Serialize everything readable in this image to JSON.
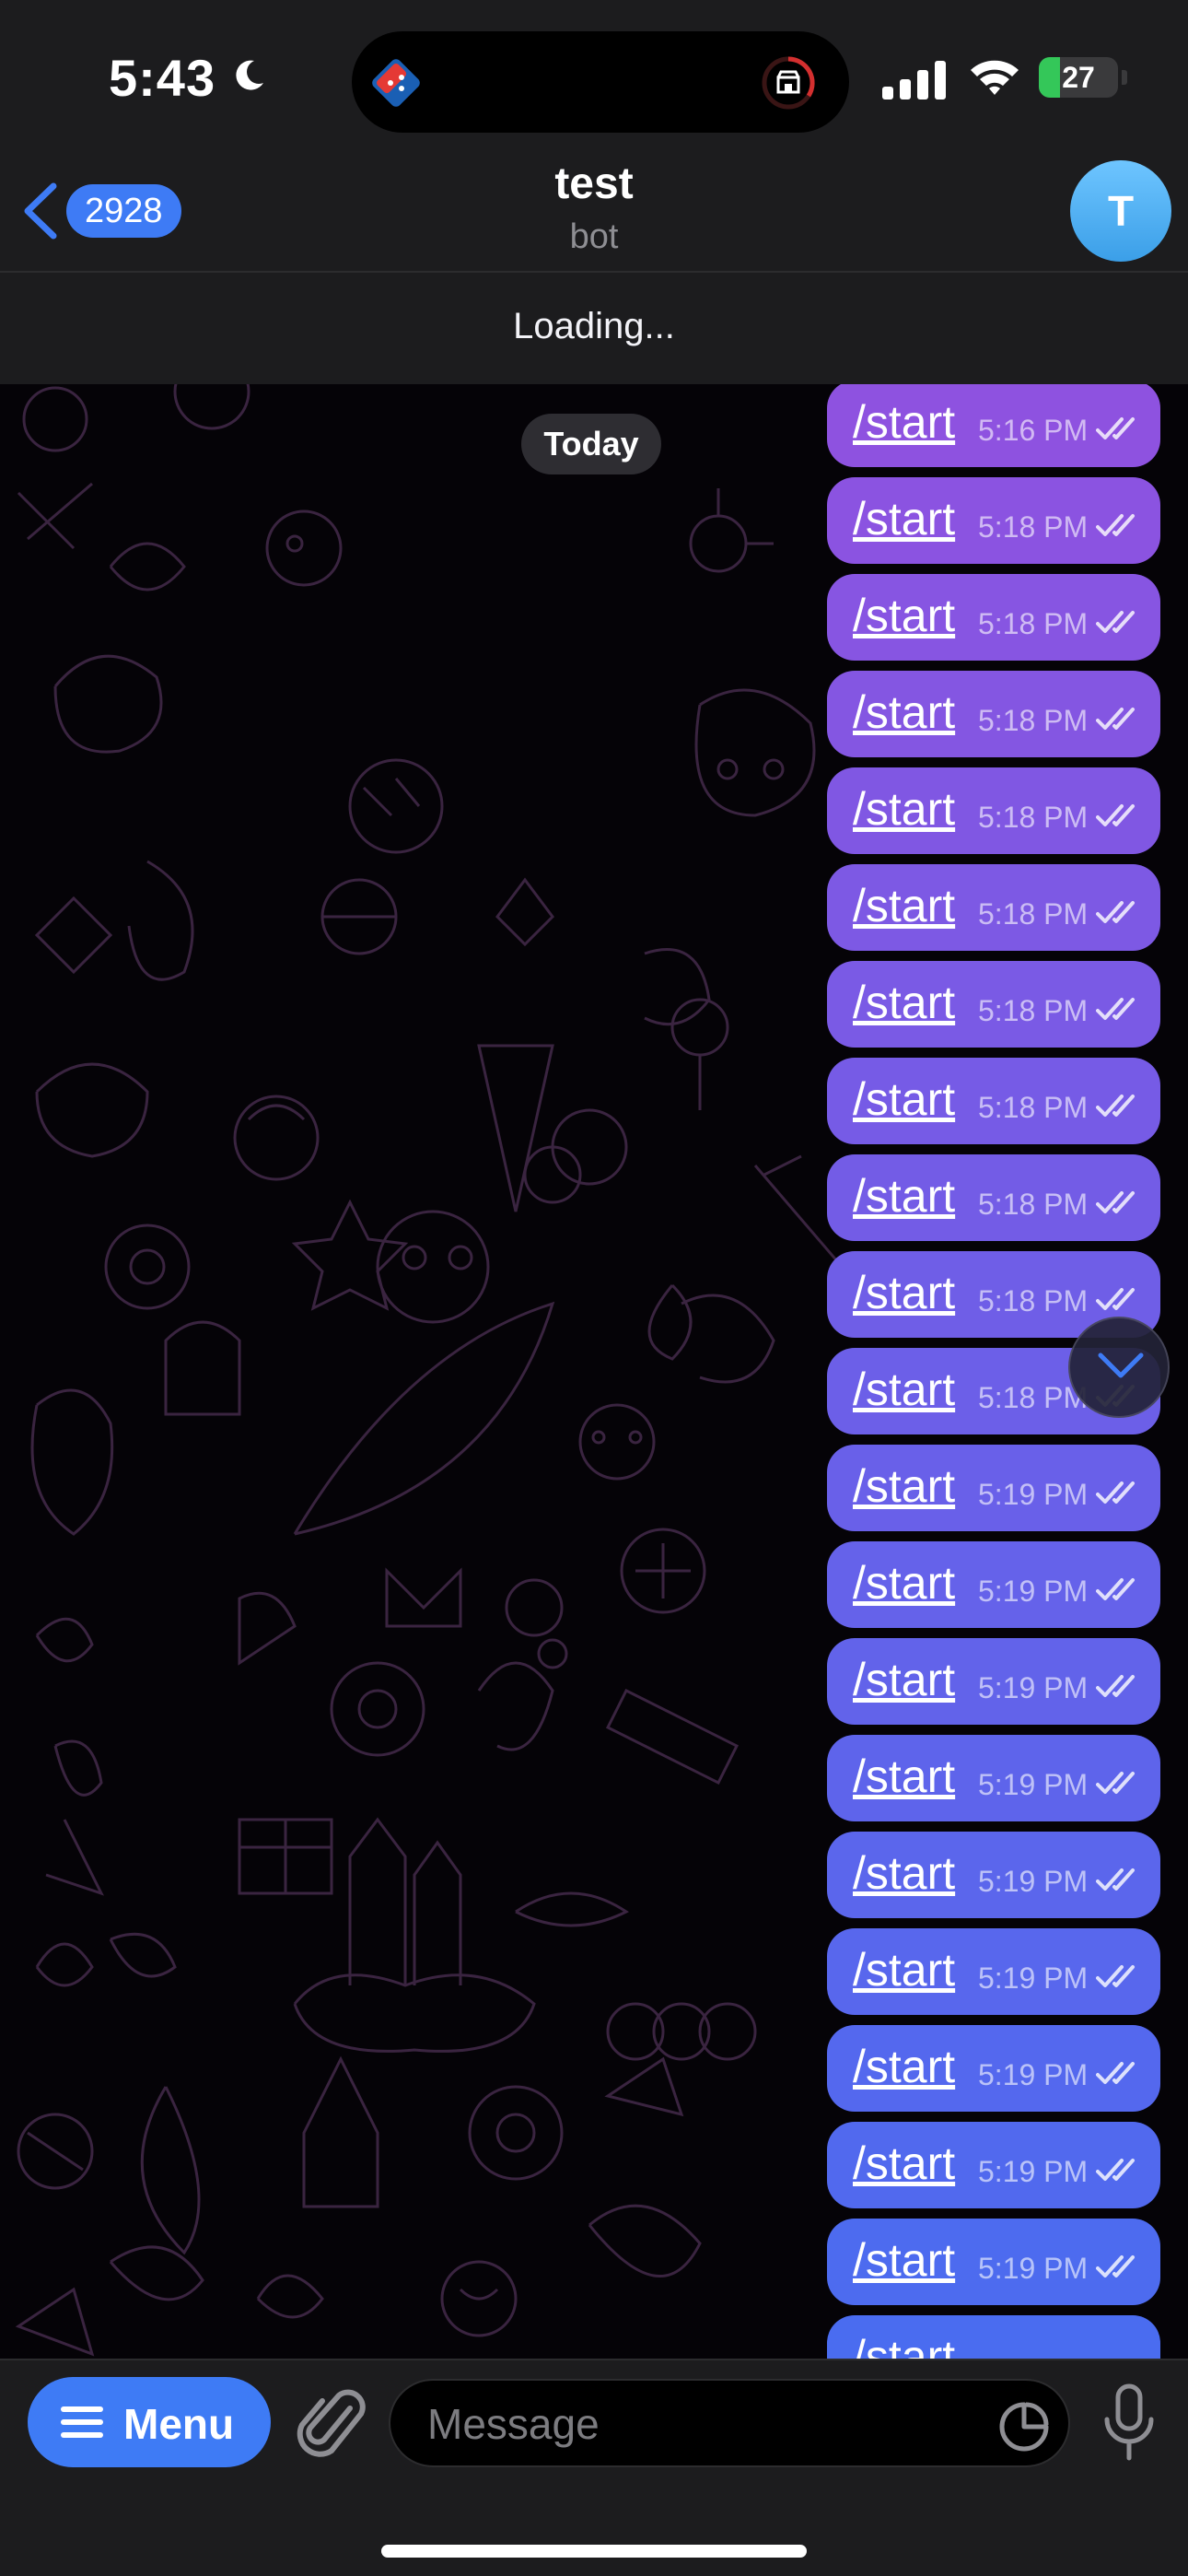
{
  "status_bar": {
    "time": "5:43",
    "battery": "27",
    "battery_level": 0.27
  },
  "header": {
    "back_count": "2928",
    "title": "test",
    "subtitle": "bot",
    "avatar_letter": "T",
    "loading": "Loading..."
  },
  "chat": {
    "date_chip": "Today",
    "messages": [
      {
        "text": "/start",
        "time": "5:16 PM"
      },
      {
        "text": "/start",
        "time": "5:18 PM"
      },
      {
        "text": "/start",
        "time": "5:18 PM"
      },
      {
        "text": "/start",
        "time": "5:18 PM"
      },
      {
        "text": "/start",
        "time": "5:18 PM"
      },
      {
        "text": "/start",
        "time": "5:18 PM"
      },
      {
        "text": "/start",
        "time": "5:18 PM"
      },
      {
        "text": "/start",
        "time": "5:18 PM"
      },
      {
        "text": "/start",
        "time": "5:18 PM"
      },
      {
        "text": "/start",
        "time": "5:18 PM"
      },
      {
        "text": "/start",
        "time": "5:18 PM"
      },
      {
        "text": "/start",
        "time": "5:19 PM"
      },
      {
        "text": "/start",
        "time": "5:19 PM"
      },
      {
        "text": "/start",
        "time": "5:19 PM"
      },
      {
        "text": "/start",
        "time": "5:19 PM"
      },
      {
        "text": "/start",
        "time": "5:19 PM"
      },
      {
        "text": "/start",
        "time": "5:19 PM"
      },
      {
        "text": "/start",
        "time": "5:19 PM"
      },
      {
        "text": "/start",
        "time": "5:19 PM"
      },
      {
        "text": "/start",
        "time": "5:19 PM"
      },
      {
        "text": "/start",
        "time": ""
      }
    ]
  },
  "input_bar": {
    "menu_label": "Menu",
    "placeholder": "Message"
  },
  "colors": {
    "bubble_top": "#8e52e0",
    "bubble_bottom": "#4a6cf0",
    "accent": "#3e7bf5"
  },
  "icons": {
    "back": "chevron-left-icon",
    "attach": "paperclip-icon",
    "sticker": "sticker-icon",
    "mic": "microphone-icon",
    "scroll": "chevron-down-icon",
    "menu": "hamburger-icon"
  }
}
